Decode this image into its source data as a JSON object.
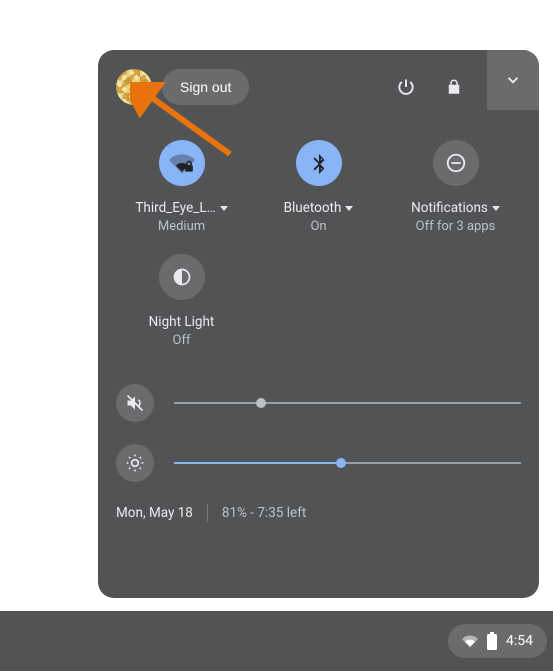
{
  "header": {
    "signout_label": "Sign out"
  },
  "tiles": {
    "wifi": {
      "label": "Third_Eye_L…",
      "sub": "Medium",
      "active": true
    },
    "bluetooth": {
      "label": "Bluetooth",
      "sub": "On",
      "active": true
    },
    "notifications": {
      "label": "Notifications",
      "sub": "Off for 3 apps",
      "active": false
    },
    "nightlight": {
      "label": "Night Light",
      "sub": "Off",
      "active": false
    }
  },
  "sliders": {
    "volume_pct": 25,
    "brightness_pct": 48
  },
  "footer": {
    "date": "Mon, May 18",
    "battery": "81% - 7:35 left"
  },
  "tray": {
    "time": "4:54"
  }
}
